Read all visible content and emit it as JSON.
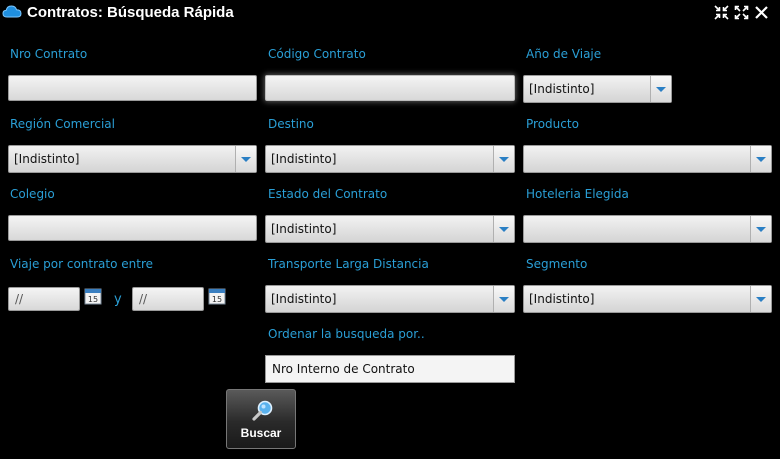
{
  "window": {
    "title": "Contratos: Búsqueda Rápida",
    "icons": [
      "cloud-icon",
      "collapse-icon",
      "expand-icon",
      "close-icon"
    ]
  },
  "fields": {
    "nro_contrato": {
      "label": "Nro Contrato",
      "value": ""
    },
    "codigo_contrato": {
      "label": "Código Contrato",
      "value": ""
    },
    "anio_viaje": {
      "label": "Año de Viaje",
      "value": "[Indistinto]"
    },
    "region_comercial": {
      "label": "Región Comercial",
      "value": "[Indistinto]"
    },
    "destino": {
      "label": "Destino",
      "value": "[Indistinto]"
    },
    "producto": {
      "label": "Producto",
      "value": ""
    },
    "colegio": {
      "label": "Colegio",
      "value": ""
    },
    "estado_contrato": {
      "label": "Estado del Contrato",
      "value": "[Indistinto]"
    },
    "hoteleria": {
      "label": "Hoteleria Elegida",
      "value": ""
    },
    "viaje_entre": {
      "label": "Viaje por contrato entre",
      "from": "//",
      "separator": "y",
      "to": "//",
      "calendar_day": "15"
    },
    "transporte": {
      "label": "Transporte Larga Distancia",
      "value": "[Indistinto]"
    },
    "segmento": {
      "label": "Segmento",
      "value": "[Indistinto]"
    },
    "ordenar": {
      "label": "Ordenar la busqueda por..",
      "value": "Nro Interno de Contrato"
    }
  },
  "actions": {
    "buscar_label": "Buscar"
  },
  "colors": {
    "background": "#000000",
    "label": "#2a9fd6",
    "arrow": "#2a7fc4"
  }
}
